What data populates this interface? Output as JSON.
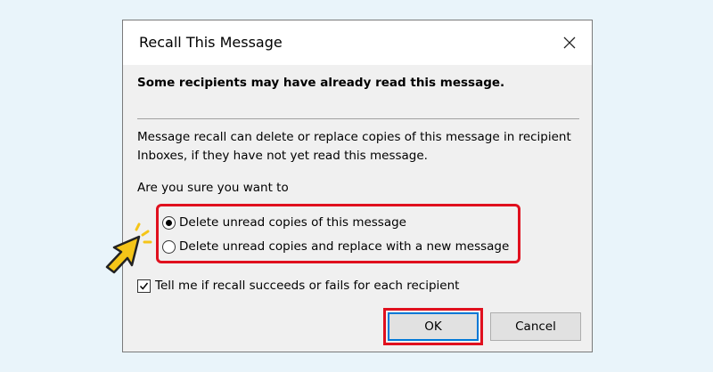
{
  "dialog": {
    "title": "Recall This Message",
    "heading": "Some recipients may have already read this message.",
    "description": "Message recall can delete or replace copies of this message in recipient Inboxes, if they have not yet read this message.",
    "prompt": "Are you sure you want to",
    "options": [
      {
        "label": "Delete unread copies of this message",
        "selected": true
      },
      {
        "label": "Delete unread copies and replace with a new message",
        "selected": false
      }
    ],
    "notify_checkbox": {
      "label": "Tell me if recall succeeds or fails for each recipient",
      "checked": true
    },
    "ok_label": "OK",
    "cancel_label": "Cancel"
  },
  "icons": {
    "close": "close-icon",
    "pointer": "hand-pointer-icon"
  },
  "colors": {
    "highlight": "#e0101e",
    "background": "#e9f4fa",
    "dialog": "#f0f0f0",
    "pointer": "#f5c518"
  }
}
